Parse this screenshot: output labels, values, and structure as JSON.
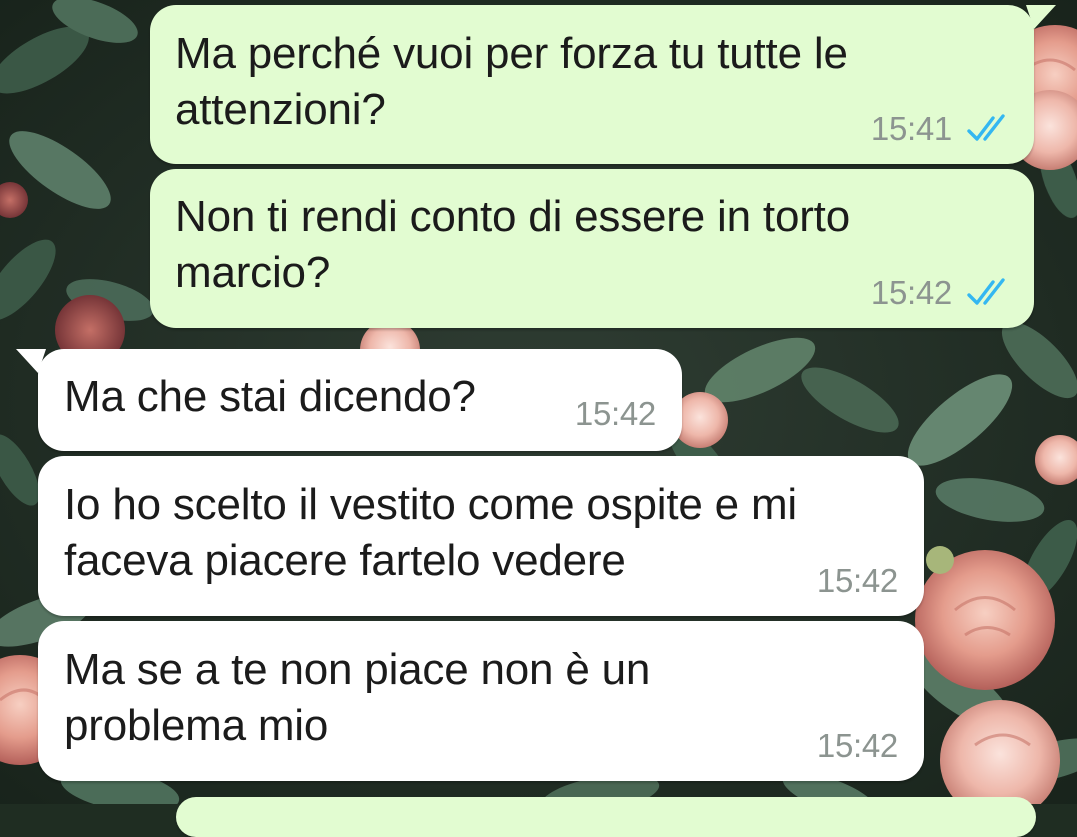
{
  "chat": {
    "messages": [
      {
        "direction": "outgoing",
        "text": "Ma perché vuoi per forza tu tutte le\nattenzioni?",
        "time": "15:41",
        "status_icon": "double-check-read-icon"
      },
      {
        "direction": "outgoing",
        "text": "Non ti rendi conto di essere in torto\nmarcio?",
        "time": "15:42",
        "status_icon": "double-check-read-icon"
      },
      {
        "direction": "incoming",
        "text": "Ma che stai dicendo?",
        "time": "15:42"
      },
      {
        "direction": "incoming",
        "text": "Io ho scelto il vestito come ospite e mi\nfaceva piacere fartelo vedere",
        "time": "15:42"
      },
      {
        "direction": "incoming",
        "text": "Ma se a te non piace non è un\nproblema mio",
        "time": "15:42"
      }
    ]
  },
  "colors": {
    "outgoing_bubble": "#e2fcd1",
    "incoming_bubble": "#ffffff",
    "read_ticks": "#34b7f1",
    "timestamp": "#8c9490"
  }
}
